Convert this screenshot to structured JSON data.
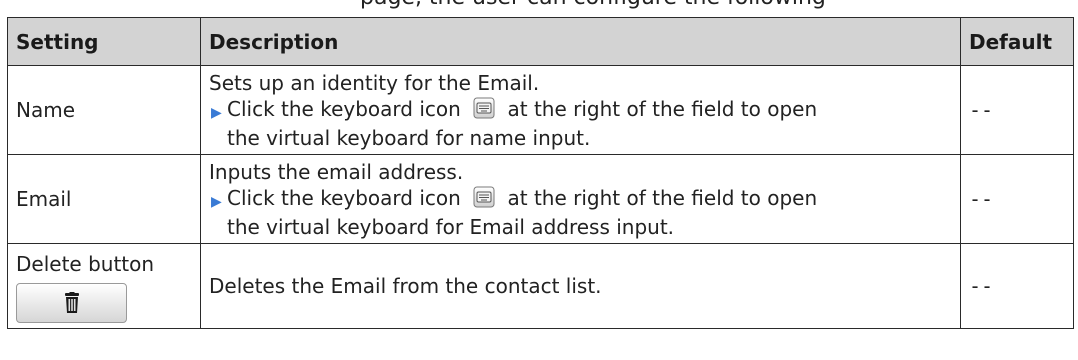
{
  "header_fragment": "page, the user can configure the following",
  "table": {
    "headers": {
      "setting": "Setting",
      "description": "Description",
      "default": "Default"
    },
    "rows": [
      {
        "setting": "Name",
        "desc_line1": "Sets up an identity for the Email.",
        "desc_bullet_pre": "Click the keyboard icon",
        "desc_bullet_post": "at the right of the field to open",
        "desc_bullet_cont": "the virtual keyboard for name input.",
        "default": "--"
      },
      {
        "setting": "Email",
        "desc_line1": "Inputs the email address.",
        "desc_bullet_pre": "Click the keyboard icon",
        "desc_bullet_post": "at the right of the field to open",
        "desc_bullet_cont": "the virtual keyboard for Email address input.",
        "default": "--"
      },
      {
        "setting": "Delete button",
        "description": "Deletes the Email from the contact list.",
        "default": "--",
        "button_icon": "trash-icon"
      }
    ]
  },
  "icons": {
    "bullet": "blue-triangle-arrow-icon",
    "keyboard": "keyboard-icon"
  },
  "colors": {
    "header_bg": "#d3d3d3",
    "border": "#2a2a2a",
    "bullet": "#3a7bd5"
  }
}
